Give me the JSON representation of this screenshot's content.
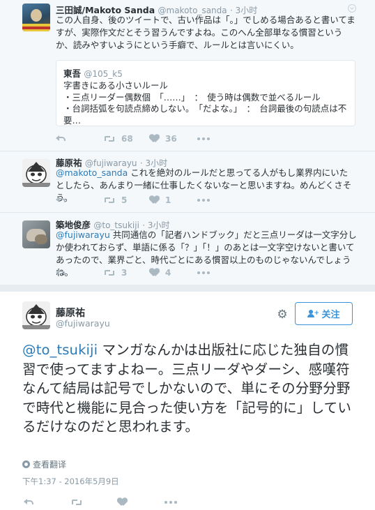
{
  "tweets": [
    {
      "name": "三田誠/Makoto Sanda",
      "handle": "@makoto_sanda",
      "time": "· 3小时",
      "text": "この人自身、後のツイートで、古い作品は「。」でしめる場合あると書いてますが、実際作文だとそう習うんですよね。このへん全部単なる慣習というか、読みやすいようにという手癖で、ルールとは言いにくい。",
      "quote": {
        "name": "東吾",
        "handle": "@105_k5",
        "lines": [
          "字書きにある小さいルール",
          "・三点リーダー偶数個　「……」　：　使う時は偶数で並べるルール",
          "・台詞括弧を句読点締めしない。　「だよな。」　：　台詞最後の句読点は不要…"
        ]
      },
      "retweets": "68",
      "likes": "36"
    },
    {
      "name": "藤原祐",
      "handle": "@fujiwarayu",
      "time": "· 3小时",
      "mention": "@makoto_sanda",
      "text": " これを絶対のルールだと思ってる人がもし業界内にいたとしたら、あんまり一緒に仕事したくないなーと思いますね。めんどくさそう。",
      "retweets": "5",
      "likes": "1"
    },
    {
      "name": "築地俊彦",
      "handle": "@to_tsukiji",
      "time": "· 3小时",
      "mention": "@fujiwarayu",
      "text": " 共同通信の「記者ハンドブック」だと三点リーダは一文字分しか使われておらず、単語に係る「？」「！」のあとは一文字空けないと書いてあったので、業界ごと、時代ごとにある慣習以上のものじゃないんでしょうね。",
      "retweets": "3",
      "likes": "4"
    }
  ],
  "main": {
    "name": "藤原祐",
    "handle": "@fujiwarayu",
    "follow_label": "关注",
    "mention": "@to_tsukiji",
    "text": " マンガなんかは出版社に応じた独自の慣習で使ってますよねー。三点リーダやダーシ、感嘆符なんて結局は記号でしかないので、単にその分野分野で時代と機能に見合った使い方を「記号的に」しているだけなのだと思われます。",
    "translate_label": "查看翻译",
    "timestamp": "下午1:37 - 2016年5月9日"
  },
  "colors": {
    "link": "#2b7bb9",
    "follow": "#3b94d9",
    "muted": "#8899a6",
    "bg_conv": "#f5f8fa"
  },
  "icons": [
    "reply-icon",
    "retweet-icon",
    "like-icon",
    "more-icon",
    "gear-icon",
    "follow-person-icon",
    "globe-icon",
    "caret-down-icon"
  ]
}
